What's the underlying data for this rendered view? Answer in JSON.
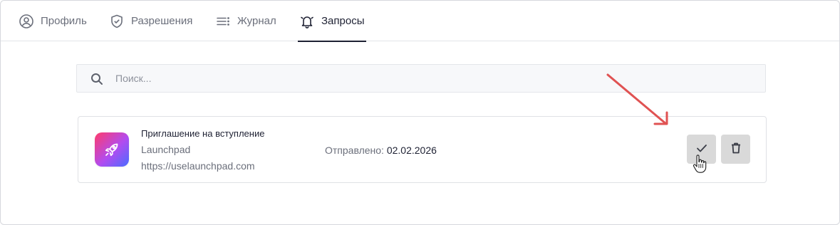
{
  "tabs": [
    {
      "label": "Профиль",
      "icon": "user-circle-icon"
    },
    {
      "label": "Разрешения",
      "icon": "shield-check-icon"
    },
    {
      "label": "Журнал",
      "icon": "list-icon"
    },
    {
      "label": "Запросы",
      "icon": "bell-icon",
      "active": true
    }
  ],
  "search": {
    "placeholder": "Поиск..."
  },
  "request": {
    "title": "Приглашение на вступление",
    "app_name": "Launchpad",
    "url": "https://uselaunchpad.com",
    "sent_label": "Отправлено:",
    "sent_date": "02.02.2026",
    "logo_icon": "rocket-icon",
    "accept_icon": "check-icon",
    "delete_icon": "trash-icon"
  },
  "colors": {
    "accent": "#1e2133",
    "muted_text": "#6b6f7b",
    "button_bg": "#d9d9d9",
    "annotation_arrow": "#e05252",
    "logo_gradient": [
      "#ff3b6b",
      "#b14cf0",
      "#4a6cff"
    ]
  }
}
